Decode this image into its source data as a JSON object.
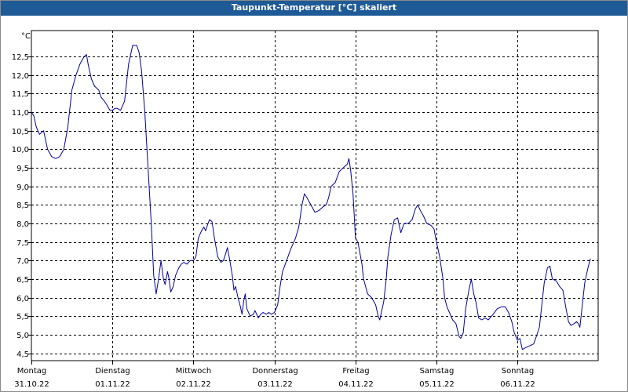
{
  "window": {
    "title": "Taupunkt-Temperatur [°C] skaliert"
  },
  "chart_data": {
    "type": "line",
    "title": "Taupunkt-Temperatur [°C] skaliert",
    "ylabel": "°C",
    "ylim": [
      4.3,
      13.2
    ],
    "y_ticks": [
      "4,5",
      "5,0",
      "5,5",
      "6,0",
      "6,5",
      "7,0",
      "7,5",
      "8,0",
      "8,5",
      "9,0",
      "9,5",
      "10,0",
      "10,5",
      "11,0",
      "11,5",
      "12,0",
      "12,5"
    ],
    "y_tick_values": [
      4.5,
      5.0,
      5.5,
      6.0,
      6.5,
      7.0,
      7.5,
      8.0,
      8.5,
      9.0,
      9.5,
      10.0,
      10.5,
      11.0,
      11.5,
      12.0,
      12.5
    ],
    "x_days": [
      {
        "day": "Montag",
        "date": "31.10.22"
      },
      {
        "day": "Dienstag",
        "date": "01.11.22"
      },
      {
        "day": "Mittwoch",
        "date": "02.11.22"
      },
      {
        "day": "Donnerstag",
        "date": "03.11.22"
      },
      {
        "day": "Freitag",
        "date": "04.11.22"
      },
      {
        "day": "Samstag",
        "date": "05.11.22"
      },
      {
        "day": "Sonntag",
        "date": "06.11.22"
      }
    ],
    "grid": true,
    "line_color": "#0000a0",
    "series": [
      {
        "values": [
          [
            0.0,
            11.0
          ],
          [
            0.03,
            10.9
          ],
          [
            0.06,
            10.6
          ],
          [
            0.1,
            10.4
          ],
          [
            0.15,
            10.5
          ],
          [
            0.2,
            10.0
          ],
          [
            0.25,
            9.8
          ],
          [
            0.3,
            9.75
          ],
          [
            0.35,
            9.8
          ],
          [
            0.4,
            10.0
          ],
          [
            0.45,
            10.6
          ],
          [
            0.5,
            11.6
          ],
          [
            0.55,
            12.0
          ],
          [
            0.6,
            12.3
          ],
          [
            0.65,
            12.5
          ],
          [
            0.68,
            12.55
          ],
          [
            0.7,
            12.3
          ],
          [
            0.74,
            11.9
          ],
          [
            0.78,
            11.7
          ],
          [
            0.83,
            11.6
          ],
          [
            0.86,
            11.4
          ],
          [
            0.9,
            11.3
          ],
          [
            0.93,
            11.2
          ],
          [
            0.97,
            11.05
          ],
          [
            1.0,
            11.05
          ],
          [
            1.03,
            11.1
          ],
          [
            1.06,
            11.1
          ],
          [
            1.1,
            11.05
          ],
          [
            1.15,
            11.3
          ],
          [
            1.2,
            12.3
          ],
          [
            1.25,
            12.8
          ],
          [
            1.3,
            12.8
          ],
          [
            1.33,
            12.6
          ],
          [
            1.36,
            12.1
          ],
          [
            1.4,
            11.0
          ],
          [
            1.44,
            9.5
          ],
          [
            1.48,
            8.0
          ],
          [
            1.51,
            6.6
          ],
          [
            1.54,
            6.1
          ],
          [
            1.57,
            6.5
          ],
          [
            1.6,
            7.0
          ],
          [
            1.63,
            6.5
          ],
          [
            1.65,
            6.35
          ],
          [
            1.68,
            6.7
          ],
          [
            1.7,
            6.5
          ],
          [
            1.72,
            6.15
          ],
          [
            1.75,
            6.3
          ],
          [
            1.78,
            6.6
          ],
          [
            1.82,
            6.8
          ],
          [
            1.85,
            6.9
          ],
          [
            1.88,
            6.95
          ],
          [
            1.92,
            6.9
          ],
          [
            1.96,
            7.0
          ],
          [
            2.0,
            7.0
          ],
          [
            2.03,
            7.1
          ],
          [
            2.06,
            7.6
          ],
          [
            2.1,
            7.8
          ],
          [
            2.13,
            7.9
          ],
          [
            2.15,
            7.8
          ],
          [
            2.18,
            8.0
          ],
          [
            2.2,
            8.1
          ],
          [
            2.23,
            8.05
          ],
          [
            2.26,
            7.6
          ],
          [
            2.3,
            7.1
          ],
          [
            2.34,
            6.95
          ],
          [
            2.37,
            7.0
          ],
          [
            2.4,
            7.2
          ],
          [
            2.42,
            7.35
          ],
          [
            2.45,
            7.0
          ],
          [
            2.48,
            6.6
          ],
          [
            2.5,
            6.2
          ],
          [
            2.52,
            6.3
          ],
          [
            2.55,
            6.0
          ],
          [
            2.58,
            5.75
          ],
          [
            2.6,
            5.55
          ],
          [
            2.62,
            5.9
          ],
          [
            2.64,
            6.1
          ],
          [
            2.66,
            5.7
          ],
          [
            2.7,
            5.5
          ],
          [
            2.74,
            5.55
          ],
          [
            2.76,
            5.65
          ],
          [
            2.8,
            5.45
          ],
          [
            2.83,
            5.55
          ],
          [
            2.86,
            5.6
          ],
          [
            2.9,
            5.55
          ],
          [
            2.93,
            5.6
          ],
          [
            2.96,
            5.55
          ],
          [
            3.0,
            5.6
          ],
          [
            3.04,
            5.8
          ],
          [
            3.07,
            6.3
          ],
          [
            3.1,
            6.7
          ],
          [
            3.15,
            7.0
          ],
          [
            3.2,
            7.3
          ],
          [
            3.26,
            7.6
          ],
          [
            3.3,
            7.9
          ],
          [
            3.34,
            8.5
          ],
          [
            3.37,
            8.8
          ],
          [
            3.4,
            8.7
          ],
          [
            3.45,
            8.5
          ],
          [
            3.5,
            8.3
          ],
          [
            3.55,
            8.35
          ],
          [
            3.6,
            8.45
          ],
          [
            3.64,
            8.5
          ],
          [
            3.67,
            8.7
          ],
          [
            3.7,
            9.0
          ],
          [
            3.75,
            9.1
          ],
          [
            3.8,
            9.4
          ],
          [
            3.85,
            9.5
          ],
          [
            3.9,
            9.6
          ],
          [
            3.92,
            9.75
          ],
          [
            3.94,
            9.45
          ],
          [
            3.97,
            8.8
          ],
          [
            3.99,
            8.0
          ],
          [
            4.0,
            7.6
          ],
          [
            4.03,
            7.5
          ],
          [
            4.08,
            6.9
          ],
          [
            4.1,
            6.5
          ],
          [
            4.15,
            6.1
          ],
          [
            4.2,
            6.0
          ],
          [
            4.25,
            5.8
          ],
          [
            4.28,
            5.5
          ],
          [
            4.3,
            5.4
          ],
          [
            4.35,
            5.9
          ],
          [
            4.38,
            6.5
          ],
          [
            4.4,
            7.1
          ],
          [
            4.44,
            7.7
          ],
          [
            4.48,
            8.1
          ],
          [
            4.52,
            8.15
          ],
          [
            4.56,
            7.75
          ],
          [
            4.6,
            8.0
          ],
          [
            4.65,
            8.0
          ],
          [
            4.7,
            8.1
          ],
          [
            4.74,
            8.4
          ],
          [
            4.77,
            8.5
          ],
          [
            4.8,
            8.35
          ],
          [
            4.84,
            8.2
          ],
          [
            4.88,
            8.0
          ],
          [
            4.93,
            7.95
          ],
          [
            4.97,
            7.85
          ],
          [
            5.0,
            7.5
          ],
          [
            5.04,
            7.1
          ],
          [
            5.08,
            6.5
          ],
          [
            5.1,
            6.0
          ],
          [
            5.13,
            5.75
          ],
          [
            5.16,
            5.6
          ],
          [
            5.2,
            5.4
          ],
          [
            5.24,
            5.3
          ],
          [
            5.28,
            4.95
          ],
          [
            5.3,
            4.9
          ],
          [
            5.33,
            5.05
          ],
          [
            5.36,
            5.7
          ],
          [
            5.4,
            6.2
          ],
          [
            5.43,
            6.5
          ],
          [
            5.46,
            6.1
          ],
          [
            5.49,
            5.85
          ],
          [
            5.52,
            5.45
          ],
          [
            5.56,
            5.4
          ],
          [
            5.6,
            5.45
          ],
          [
            5.64,
            5.4
          ],
          [
            5.7,
            5.55
          ],
          [
            5.75,
            5.7
          ],
          [
            5.8,
            5.75
          ],
          [
            5.85,
            5.75
          ],
          [
            5.89,
            5.6
          ],
          [
            5.93,
            5.35
          ],
          [
            5.96,
            5.05
          ],
          [
            6.0,
            4.85
          ],
          [
            6.03,
            4.9
          ],
          [
            6.06,
            4.6
          ],
          [
            6.1,
            4.65
          ],
          [
            6.15,
            4.7
          ],
          [
            6.2,
            4.75
          ],
          [
            6.24,
            5.0
          ],
          [
            6.27,
            5.2
          ],
          [
            6.3,
            5.8
          ],
          [
            6.33,
            6.4
          ],
          [
            6.37,
            6.8
          ],
          [
            6.4,
            6.85
          ],
          [
            6.43,
            6.5
          ],
          [
            6.48,
            6.45
          ],
          [
            6.52,
            6.3
          ],
          [
            6.56,
            6.2
          ],
          [
            6.6,
            5.7
          ],
          [
            6.63,
            5.35
          ],
          [
            6.66,
            5.25
          ],
          [
            6.7,
            5.3
          ],
          [
            6.73,
            5.35
          ],
          [
            6.75,
            5.3
          ],
          [
            6.77,
            5.2
          ],
          [
            6.8,
            5.8
          ],
          [
            6.83,
            6.4
          ],
          [
            6.87,
            6.8
          ],
          [
            6.9,
            7.05
          ]
        ]
      }
    ]
  }
}
